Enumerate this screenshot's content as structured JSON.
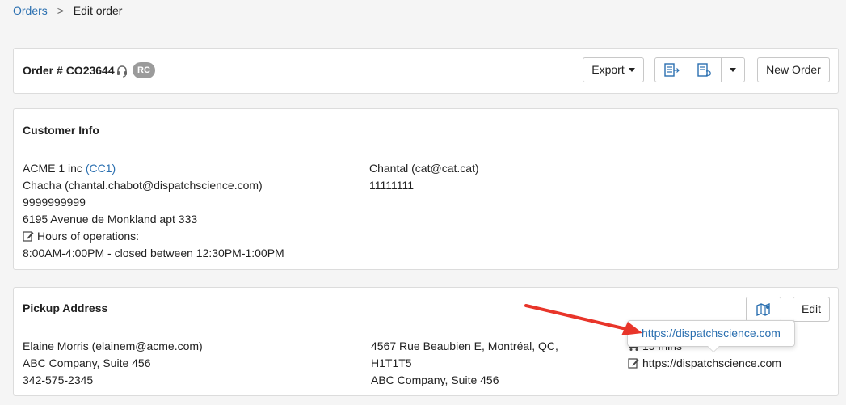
{
  "breadcrumb": {
    "parent": "Orders",
    "separator": ">",
    "current": "Edit order"
  },
  "order": {
    "title": "Order # CO23644",
    "badge": "RC"
  },
  "toolbar": {
    "export_label": "Export",
    "new_order_label": "New Order"
  },
  "customer": {
    "heading": "Customer Info",
    "company": "ACME 1 inc",
    "company_code": "(CC1)",
    "contact": "Chacha (chantal.chabot@dispatchscience.com)",
    "phone": "9999999999",
    "address": "6195 Avenue de Monkland apt 333",
    "hours_label": "Hours of operations:",
    "hours": "8:00AM-4:00PM - closed between 12:30PM-1:00PM",
    "secondary_contact": "Chantal (cat@cat.cat)",
    "secondary_phone": "11111111"
  },
  "pickup": {
    "heading": "Pickup Address",
    "edit_label": "Edit",
    "contact": "Elaine Morris (elainem@acme.com)",
    "company": "ABC Company, Suite 456",
    "phone": "342-575-2345",
    "address_line1": "4567 Rue Beaubien E, Montréal, QC,",
    "address_line2": "H1T1T5",
    "address_line3": "ABC Company, Suite 456",
    "duration": "15 mins",
    "note": "https://dispatchscience.com"
  },
  "tooltip": {
    "text": "https://dispatchscience.com"
  },
  "colors": {
    "link": "#2a6fb0",
    "annotation_arrow": "#e8352a",
    "badge": "#9b9b9b"
  }
}
